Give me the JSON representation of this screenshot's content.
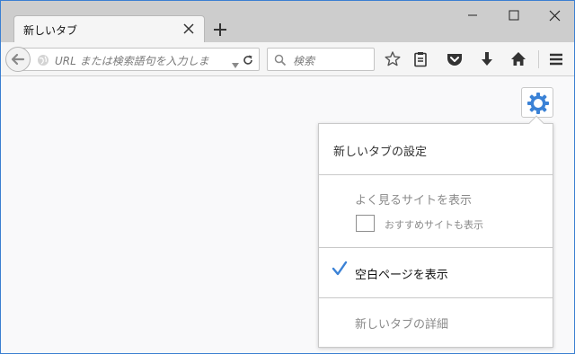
{
  "tab": {
    "title": "新しいタブ"
  },
  "navbar": {
    "url_placeholder": "URL または検索語句を入力しま",
    "search_placeholder": "検索"
  },
  "panel": {
    "title": "新しいタブの設定",
    "options": {
      "enhanced": "よく見るサイトを表示",
      "suggested": "おすすめサイトも表示",
      "blank": "空白ページを表示",
      "learn_more": "新しいタブの詳細"
    },
    "selected_option": "blank",
    "suggested_checked": false
  },
  "colors": {
    "accent": "#3b82d6",
    "window_border": "#3b7fd1",
    "tabstrip": "#cdcdcd"
  },
  "icons": {
    "back": "back-arrow-icon",
    "globe": "globe-icon",
    "dropdown": "dropdown-arrow-icon",
    "reload": "reload-icon",
    "search": "search-icon",
    "bookmark": "star-icon",
    "bookmarks_menu": "clipboard-icon",
    "pocket": "pocket-icon",
    "downloads": "download-arrow-icon",
    "home": "home-icon",
    "menu": "hamburger-menu-icon",
    "customize": "gear-icon",
    "close": "close-icon",
    "new_tab": "plus-icon"
  }
}
